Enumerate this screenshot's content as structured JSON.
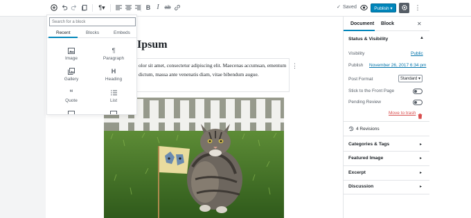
{
  "toolbar": {
    "saved": "Saved",
    "publish": "Publish ▾",
    "icons": [
      "add-block-icon",
      "undo-icon",
      "redo-icon",
      "block-navigation-icon",
      "paragraph-icon",
      "align-left-icon",
      "align-center-icon",
      "align-right-icon",
      "bold-icon",
      "italic-icon",
      "strikethrough-icon",
      "link-icon",
      "check-icon",
      "preview-icon",
      "gear-icon",
      "more-icon"
    ]
  },
  "post": {
    "title": "Ipsum",
    "paragraph": "olor sit amet, consectetur adipiscing elit. Maecenas accumsan, ementum dictum, massa ante venenatis diam, vitae bibendum augue."
  },
  "inserter": {
    "search_placeholder": "Search for a block",
    "tabs": [
      "Recent",
      "Blocks",
      "Embeds"
    ],
    "blocks": [
      "Image",
      "Paragraph",
      "Gallery",
      "Heading",
      "Quote",
      "List"
    ]
  },
  "sidebar": {
    "tabs": [
      "Document",
      "Block"
    ],
    "status_title": "Status & Visibility",
    "visibility_label": "Visibility",
    "visibility_value": "Public",
    "publish_label": "Publish",
    "publish_value": "November 26, 2017 6:34 pm",
    "format_label": "Post Format",
    "format_value": "Standard",
    "sticky_label": "Stick to the Front Page",
    "pending_label": "Pending Review",
    "trash": "Move to trash",
    "revisions": "4 Revisions",
    "categories": "Categories & Tags",
    "featured": "Featured Image",
    "excerpt": "Excerpt",
    "discussion": "Discussion"
  },
  "colors": {
    "accent": "#0085ba",
    "link": "#0073aa",
    "danger": "#d94f4f"
  }
}
